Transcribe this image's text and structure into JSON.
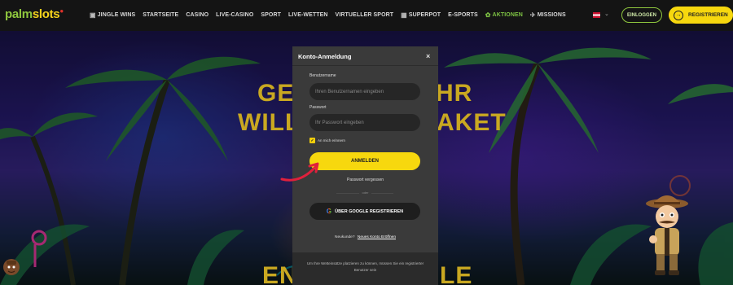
{
  "header": {
    "logo": {
      "part1": "palm",
      "part2": "slots"
    },
    "nav": [
      {
        "label": "JINGLE WINS",
        "icon": "gift-icon"
      },
      {
        "label": "STARTSEITE"
      },
      {
        "label": "CASINO"
      },
      {
        "label": "LIVE-CASINO"
      },
      {
        "label": "SPORT"
      },
      {
        "label": "LIVE-WETTEN"
      },
      {
        "label": "VIRTUELLER SPORT"
      },
      {
        "label": "SUPERPOT",
        "icon": "superpot-icon"
      },
      {
        "label": "E-SPORTS"
      },
      {
        "label": "AKTIONEN",
        "icon": "promo-icon",
        "accent": "#7dc243"
      },
      {
        "label": "MISSIONS",
        "icon": "rocket-icon"
      }
    ],
    "login_label": "EINLOGGEN",
    "register_label": "REGISTRIEREN"
  },
  "hero": {
    "line1_left": "GE",
    "line1_right": "HR",
    "line2_left": "WILL",
    "line2_right": "AKET",
    "line3_left": "EN",
    "line3_right": "LE"
  },
  "modal": {
    "title": "Konto-Anmeldung",
    "close": "×",
    "username_label": "Benutzername",
    "username_placeholder": "Ihren Benutzernamen eingeben",
    "password_label": "Passwort",
    "password_placeholder": "Ihr Passwort eingeben",
    "remember_label": "An mich erinnern",
    "remember_checked": true,
    "submit_label": "ANMELDEN",
    "forgot_label": "Passwort vergessen",
    "or_label": "oder",
    "google_label": "ÜBER GOOGLE REGISTRIEREN",
    "new_customer_prompt": "Neukunde?",
    "new_customer_link": "Neues Konto Eröffnen",
    "footer_text": "Um Ihre Wetteinsätze platzieren zu können, müssen Sie ein registrierter Benutzer sein"
  },
  "colors": {
    "brand_green": "#8fc73e",
    "brand_yellow": "#f7d80e",
    "modal_bg": "#3a3a3a",
    "header_bg": "#141414"
  }
}
